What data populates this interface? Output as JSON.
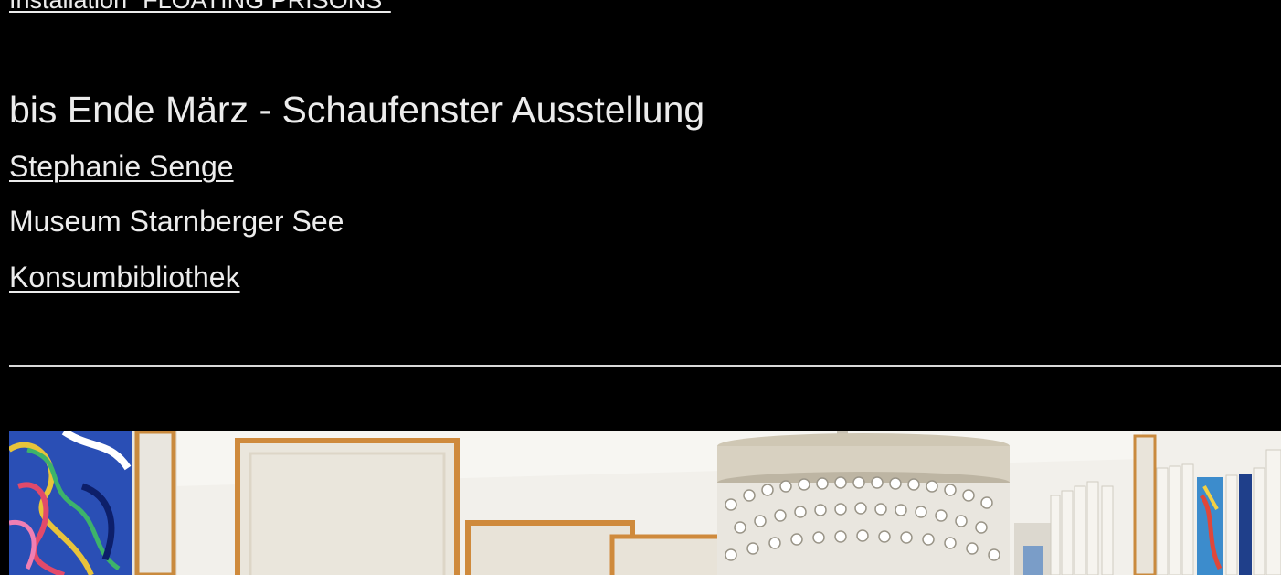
{
  "top_link": "Installation \"FLOATING PRISONS\"",
  "event": {
    "heading": "bis Ende März - Schaufenster Ausstellung",
    "artist_link": "Stephanie Senge",
    "venue": "Museum Starnberger See",
    "venue_link": "Konsumbibliothek"
  },
  "photo": {
    "icon": "photo-studio-chandelier"
  },
  "colors": {
    "background": "#000000",
    "text": "#ececec",
    "divider": "#d9d9d9"
  }
}
